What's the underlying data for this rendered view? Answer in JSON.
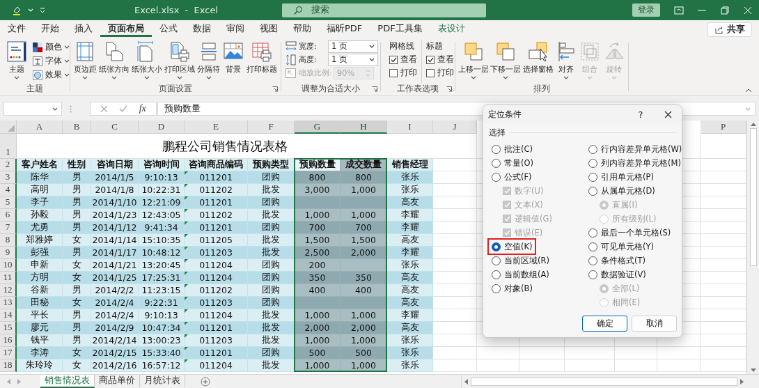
{
  "titlebar": {
    "file_title": "Excel.xlsx  -  Excel",
    "search_placeholder": "搜索",
    "sign_in": "登录"
  },
  "tabs": [
    {
      "label": "文件",
      "selected": false,
      "contextual": false
    },
    {
      "label": "开始",
      "selected": false,
      "contextual": false
    },
    {
      "label": "插入",
      "selected": false,
      "contextual": false
    },
    {
      "label": "页面布局",
      "selected": true,
      "contextual": false
    },
    {
      "label": "公式",
      "selected": false,
      "contextual": false
    },
    {
      "label": "数据",
      "selected": false,
      "contextual": false
    },
    {
      "label": "审阅",
      "selected": false,
      "contextual": false
    },
    {
      "label": "视图",
      "selected": false,
      "contextual": false
    },
    {
      "label": "帮助",
      "selected": false,
      "contextual": false
    },
    {
      "label": "福昕PDF",
      "selected": false,
      "contextual": false
    },
    {
      "label": "PDF工具集",
      "selected": false,
      "contextual": false
    },
    {
      "label": "表设计",
      "selected": false,
      "contextual": true
    }
  ],
  "share": "共享",
  "ribbon": {
    "groups": [
      {
        "label": "主题",
        "kind": "theme",
        "launcher": false,
        "large": {
          "label": "主题"
        },
        "small": [
          {
            "label": "颜色"
          },
          {
            "label": "字体"
          },
          {
            "label": "效果"
          }
        ]
      },
      {
        "label": "页面设置",
        "kind": "buttons",
        "launcher": true,
        "buttons": [
          {
            "label": "页边距",
            "caret": true,
            "disabled": false
          },
          {
            "label": "纸张方向",
            "caret": true,
            "disabled": false
          },
          {
            "label": "纸张大小",
            "caret": true,
            "disabled": false
          },
          {
            "label": "打印区域",
            "caret": true,
            "disabled": false
          },
          {
            "label": "分隔符",
            "caret": true,
            "disabled": false
          },
          {
            "label": "背景",
            "caret": false,
            "disabled": false
          },
          {
            "label": "打印标题",
            "caret": false,
            "disabled": false
          }
        ]
      },
      {
        "label": "调整为合适大小",
        "kind": "scale",
        "launcher": true,
        "fields": [
          {
            "label": "宽度:",
            "value": "1 页",
            "disabled": false
          },
          {
            "label": "高度:",
            "value": "1 页",
            "disabled": false
          },
          {
            "label": "缩放比例:",
            "value": "90%",
            "disabled": true
          }
        ]
      },
      {
        "label": "工作表选项",
        "kind": "options",
        "launcher": true,
        "sections": [
          {
            "label": "网格线",
            "items": [
              {
                "label": "查看",
                "checked": true
              },
              {
                "label": "打印",
                "checked": false
              }
            ]
          },
          {
            "label": "标题",
            "items": [
              {
                "label": "查看",
                "checked": true
              },
              {
                "label": "打印",
                "checked": false
              }
            ]
          }
        ]
      },
      {
        "label": "排列",
        "kind": "buttons",
        "launcher": false,
        "buttons": [
          {
            "label": "上移一层",
            "caret": true,
            "disabled": false
          },
          {
            "label": "下移一层",
            "caret": true,
            "disabled": false
          },
          {
            "label": "选择窗格",
            "caret": false,
            "disabled": false
          },
          {
            "label": "对齐",
            "caret": true,
            "disabled": false
          },
          {
            "label": "组合",
            "caret": true,
            "disabled": true
          },
          {
            "label": "旋转",
            "caret": true,
            "disabled": true
          }
        ]
      }
    ]
  },
  "formula_bar": {
    "fx_label": "fx",
    "formula": "预购数量"
  },
  "sheet": {
    "columns": [
      {
        "letter": "A",
        "selected": false,
        "flagged": false
      },
      {
        "letter": "B",
        "selected": false,
        "flagged": false
      },
      {
        "letter": "C",
        "selected": false,
        "flagged": false
      },
      {
        "letter": "D",
        "selected": false,
        "flagged": false
      },
      {
        "letter": "E",
        "selected": false,
        "flagged": true
      },
      {
        "letter": "F",
        "selected": false,
        "flagged": false
      },
      {
        "letter": "G",
        "selected": true,
        "flagged": false
      },
      {
        "letter": "H",
        "selected": true,
        "flagged": false
      },
      {
        "letter": "I",
        "selected": false,
        "flagged": false
      }
    ],
    "columns_after": [
      {
        "letter": "J",
        "selected": false
      }
    ],
    "columns_right": [
      {
        "letter": "P",
        "selected": false
      }
    ],
    "rows": [
      {
        "number": "1",
        "kind": "title",
        "selected": false,
        "text": "鹏程公司销售情况表格"
      },
      {
        "number": "2",
        "kind": "header",
        "selected": true,
        "cells": [
          "客户姓名",
          "性别",
          "咨询日期",
          "咨询时间",
          "咨询商品编码",
          "预购类型",
          "预购数量",
          "成交数量",
          "销售经理"
        ]
      },
      {
        "number": "3",
        "kind": "data",
        "selected": true,
        "cells": [
          "陈华",
          "男",
          "2014/1/5",
          "9:10:13",
          "011201",
          "团购",
          "800",
          "800",
          "张乐"
        ]
      },
      {
        "number": "4",
        "kind": "data",
        "selected": true,
        "cells": [
          "高明",
          "男",
          "2014/1/8",
          "10:22:31",
          "011202",
          "批发",
          "3,000",
          "1,000",
          "张乐"
        ]
      },
      {
        "number": "5",
        "kind": "data",
        "selected": true,
        "cells": [
          "李子",
          "男",
          "2014/1/10",
          "12:21:09",
          "011201",
          "团购",
          null,
          null,
          "高友"
        ]
      },
      {
        "number": "6",
        "kind": "data",
        "selected": true,
        "cells": [
          "孙毅",
          "男",
          "2014/1/23",
          "12:43:05",
          "011202",
          "批发",
          "1,000",
          "1,000",
          "李耀"
        ]
      },
      {
        "number": "7",
        "kind": "data",
        "selected": true,
        "cells": [
          "尤勇",
          "男",
          "2014/1/12",
          "9:41:34",
          "011201",
          "团购",
          "700",
          "700",
          "李耀"
        ]
      },
      {
        "number": "8",
        "kind": "data",
        "selected": true,
        "cells": [
          "郑雅婷",
          "女",
          "2014/1/14",
          "15:10:35",
          "011205",
          "批发",
          "1,500",
          "1,500",
          "高友"
        ]
      },
      {
        "number": "9",
        "kind": "data",
        "selected": true,
        "cells": [
          "彭强",
          "男",
          "2014/1/17",
          "10:48:12",
          "011203",
          "批发",
          "2,500",
          "2,000",
          "李耀"
        ]
      },
      {
        "number": "10",
        "kind": "data",
        "selected": true,
        "cells": [
          "申新",
          "女",
          "2014/1/21",
          "13:20:45",
          "011204",
          "团购",
          "200",
          null,
          "张乐"
        ]
      },
      {
        "number": "11",
        "kind": "data",
        "selected": true,
        "cells": [
          "方明",
          "女",
          "2014/1/25",
          "17:25:31",
          "011204",
          "团购",
          "350",
          "350",
          "高友"
        ]
      },
      {
        "number": "12",
        "kind": "data",
        "selected": true,
        "cells": [
          "谷新",
          "男",
          "2014/2/2",
          "11:23:15",
          "011202",
          "团购",
          "400",
          "400",
          "高友"
        ]
      },
      {
        "number": "13",
        "kind": "data",
        "selected": true,
        "cells": [
          "田秘",
          "女",
          "2014/2/4",
          "9:22:31",
          "011203",
          "团购",
          null,
          null,
          "高友"
        ]
      },
      {
        "number": "14",
        "kind": "data",
        "selected": true,
        "cells": [
          "平长",
          "男",
          "2014/2/4",
          "9:10:13",
          "011204",
          "批发",
          "1,000",
          "1,000",
          "李耀"
        ]
      },
      {
        "number": "15",
        "kind": "data",
        "selected": true,
        "cells": [
          "廖元",
          "男",
          "2014/2/9",
          "10:47:34",
          "011201",
          "批发",
          "2,000",
          "2,000",
          "高友"
        ]
      },
      {
        "number": "16",
        "kind": "data",
        "selected": true,
        "cells": [
          "钱平",
          "男",
          "2014/2/14",
          "13:00:23",
          "011203",
          "批发",
          "1,000",
          "1,000",
          "张乐"
        ]
      },
      {
        "number": "17",
        "kind": "data",
        "selected": true,
        "cells": [
          "李涛",
          "女",
          "2014/2/15",
          "15:33:40",
          "011201",
          "团购",
          "500",
          "500",
          "张乐"
        ]
      },
      {
        "number": "18",
        "kind": "data",
        "selected": true,
        "cells": [
          "朱玲玲",
          "女",
          "2014/2/16",
          "16:57:12",
          "011204",
          "批发",
          "1,000",
          "1,000",
          "张乐"
        ]
      }
    ]
  },
  "sheet_tabs": [
    {
      "label": "销售情况表",
      "selected": true
    },
    {
      "label": "商品单价",
      "selected": false
    },
    {
      "label": "月统计表",
      "selected": false
    }
  ],
  "dialog": {
    "title": "定位条件",
    "help": "?",
    "section": "选择",
    "left": [
      {
        "label": "批注(C)",
        "kind": "radio",
        "selected": false,
        "disabled": false,
        "highlighted": false
      },
      {
        "label": "常量(O)",
        "kind": "radio",
        "selected": false,
        "disabled": false,
        "highlighted": false
      },
      {
        "label": "公式(F)",
        "kind": "radio",
        "selected": false,
        "disabled": false,
        "highlighted": false,
        "children": [
          {
            "label": "数字(U)",
            "kind": "checkbox",
            "checked": true,
            "disabled": true
          },
          {
            "label": "文本(X)",
            "kind": "checkbox",
            "checked": true,
            "disabled": true
          },
          {
            "label": "逻辑值(G)",
            "kind": "checkbox",
            "checked": true,
            "disabled": true
          },
          {
            "label": "错误(E)",
            "kind": "checkbox",
            "checked": true,
            "disabled": true
          }
        ]
      },
      {
        "label": "空值(K)",
        "kind": "radio",
        "selected": true,
        "disabled": false,
        "highlighted": true
      },
      {
        "label": "当前区域(R)",
        "kind": "radio",
        "selected": false,
        "disabled": false,
        "highlighted": false
      },
      {
        "label": "当前数组(A)",
        "kind": "radio",
        "selected": false,
        "disabled": false,
        "highlighted": false
      },
      {
        "label": "对象(B)",
        "kind": "radio",
        "selected": false,
        "disabled": false,
        "highlighted": false
      }
    ],
    "right": [
      {
        "label": "行内容差异单元格(W)",
        "kind": "radio",
        "selected": false,
        "disabled": false,
        "highlighted": false
      },
      {
        "label": "列内容差异单元格(M)",
        "kind": "radio",
        "selected": false,
        "disabled": false,
        "highlighted": false
      },
      {
        "label": "引用单元格(P)",
        "kind": "radio",
        "selected": false,
        "disabled": false,
        "highlighted": false
      },
      {
        "label": "从属单元格(D)",
        "kind": "radio",
        "selected": false,
        "disabled": false,
        "highlighted": false,
        "children": [
          {
            "label": "直属(I)",
            "kind": "radio",
            "selected": true,
            "disabled": true
          },
          {
            "label": "所有级别(L)",
            "kind": "radio",
            "selected": false,
            "disabled": true
          }
        ]
      },
      {
        "label": "最后一个单元格(S)",
        "kind": "radio",
        "selected": false,
        "disabled": false,
        "highlighted": false
      },
      {
        "label": "可见单元格(Y)",
        "kind": "radio",
        "selected": false,
        "disabled": false,
        "highlighted": false
      },
      {
        "label": "条件格式(T)",
        "kind": "radio",
        "selected": false,
        "disabled": false,
        "highlighted": false
      },
      {
        "label": "数据验证(V)",
        "kind": "radio",
        "selected": false,
        "disabled": false,
        "highlighted": false,
        "children": [
          {
            "label": "全部(L)",
            "kind": "radio",
            "selected": true,
            "disabled": true
          },
          {
            "label": "相同(E)",
            "kind": "radio",
            "selected": false,
            "disabled": true
          }
        ]
      }
    ],
    "buttons": [
      {
        "label": "确定",
        "default": true
      },
      {
        "label": "取消",
        "default": false
      }
    ]
  }
}
